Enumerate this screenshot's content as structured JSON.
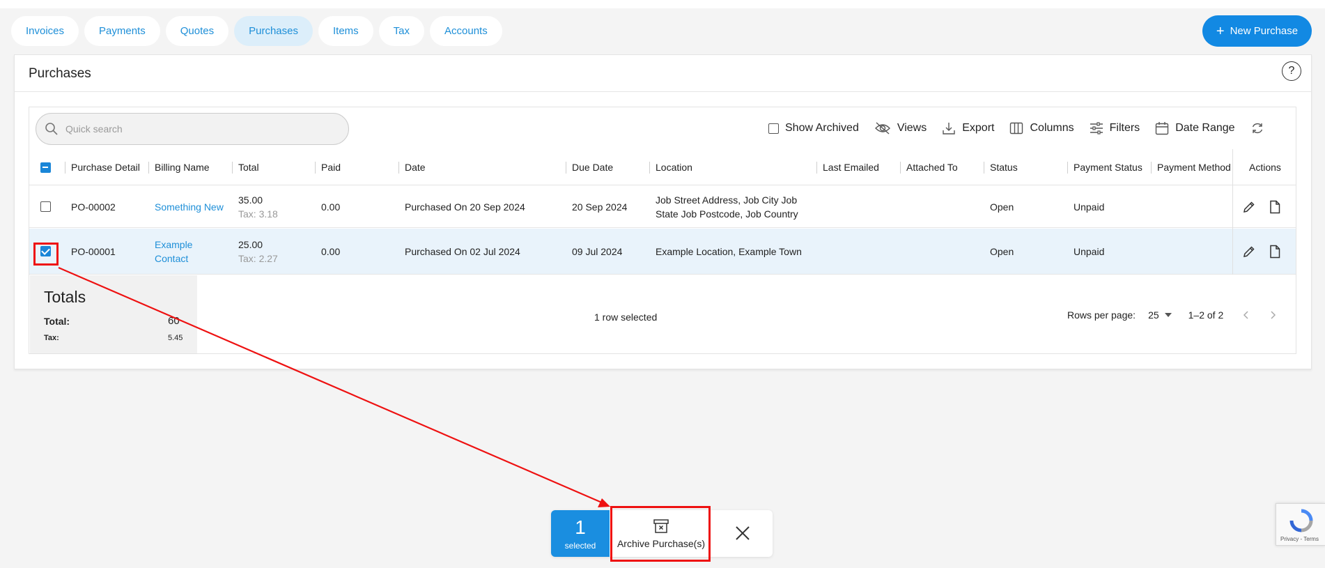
{
  "tabs": [
    {
      "label": "Invoices",
      "active": false
    },
    {
      "label": "Payments",
      "active": false
    },
    {
      "label": "Quotes",
      "active": false
    },
    {
      "label": "Purchases",
      "active": true
    },
    {
      "label": "Items",
      "active": false
    },
    {
      "label": "Tax",
      "active": false
    },
    {
      "label": "Accounts",
      "active": false
    }
  ],
  "new_button": {
    "label": "New Purchase",
    "icon": "plus-icon"
  },
  "page_title": "Purchases",
  "search": {
    "placeholder": "Quick search",
    "value": ""
  },
  "toolbar": {
    "show_archived": "Show Archived",
    "views": "Views",
    "export": "Export",
    "columns": "Columns",
    "filters": "Filters",
    "date_range": "Date Range"
  },
  "columns": [
    "Purchase Detail",
    "Billing Name",
    "Total",
    "Paid",
    "Date",
    "Due Date",
    "Location",
    "Last Emailed",
    "Attached To",
    "Status",
    "Payment Status",
    "Payment Method",
    "Actions"
  ],
  "rows": [
    {
      "selected": false,
      "purchase_detail": "PO-00002",
      "billing_name": "Something New",
      "total": "35.00",
      "tax": "Tax: 3.18",
      "paid": "0.00",
      "date": "Purchased On 20 Sep 2024",
      "due_date": "20 Sep 2024",
      "location_line1": "Job Street Address, Job City Job",
      "location_line2": "State Job Postcode, Job Country",
      "last_emailed": "",
      "attached_to": "",
      "status": "Open",
      "payment_status": "Unpaid",
      "payment_method": ""
    },
    {
      "selected": true,
      "purchase_detail": "PO-00001",
      "billing_name_line1": "Example",
      "billing_name_line2": "Contact",
      "total": "25.00",
      "tax": "Tax: 2.27",
      "paid": "0.00",
      "date": "Purchased On 02 Jul 2024",
      "due_date": "09 Jul 2024",
      "location": "Example Location, Example Town",
      "last_emailed": "",
      "attached_to": "",
      "status": "Open",
      "payment_status": "Unpaid",
      "payment_method": ""
    }
  ],
  "totals": {
    "title": "Totals",
    "total_label": "Total:",
    "total_value": "60",
    "tax_label": "Tax:",
    "tax_value": "5.45"
  },
  "selection_text": "1 row selected",
  "pagination": {
    "rows_per_page_label": "Rows per page:",
    "rows_per_page": "25",
    "range": "1–2 of 2"
  },
  "bulk_bar": {
    "count": "1",
    "count_label": "selected",
    "archive_label": "Archive Purchase(s)"
  },
  "recaptcha": {
    "links": "Privacy - Terms"
  },
  "colors": {
    "accent": "#1289e3",
    "highlight": "#ee1111",
    "selected_row": "#e9f3fb"
  }
}
